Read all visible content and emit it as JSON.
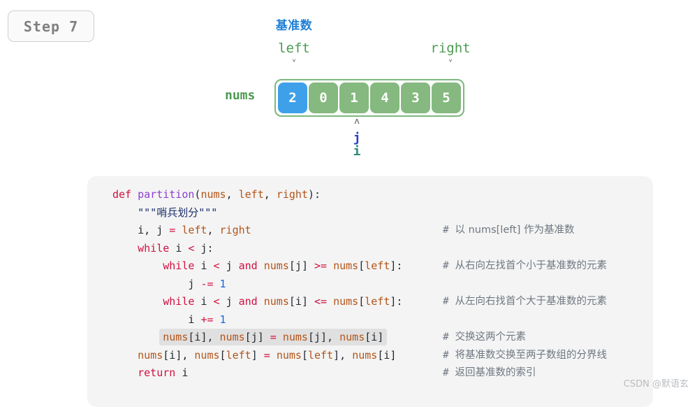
{
  "step_badge": {
    "label": "Step 7"
  },
  "diagram": {
    "pivot_title": "基准数",
    "left_label": "left",
    "right_label": "right",
    "nums_label": "nums",
    "caret_down": "ᵛ",
    "caret_up": "ᴧ",
    "pointer_j": "j",
    "pointer_i": "i",
    "colors": {
      "pivot_title": "#1d7fd6",
      "pointer_label": "#4c9a52",
      "cell_green": "#85b97f",
      "cell_blue": "#3fa0ea",
      "array_border": "#7cb87e",
      "j": "#2a40c8",
      "i": "#2d8a78"
    },
    "array": {
      "values": [
        "2",
        "0",
        "1",
        "4",
        "3",
        "5"
      ],
      "highlight_index": 0,
      "left_index": 0,
      "right_index": 5,
      "i_index": 2,
      "j_index": 2
    }
  },
  "code": {
    "language": "python",
    "highlight_line": 8,
    "lines": [
      {
        "n": 0,
        "indent": 0,
        "tokens": [
          {
            "t": "def",
            "c": "k"
          },
          {
            "t": " ",
            "c": "pl"
          },
          {
            "t": "partition",
            "c": "fn"
          },
          {
            "t": "(",
            "c": "pl"
          },
          {
            "t": "nums",
            "c": "id"
          },
          {
            "t": ", ",
            "c": "pl"
          },
          {
            "t": "left",
            "c": "id"
          },
          {
            "t": ", ",
            "c": "pl"
          },
          {
            "t": "right",
            "c": "id"
          },
          {
            "t": "):",
            "c": "pl"
          }
        ],
        "comment": ""
      },
      {
        "n": 1,
        "indent": 1,
        "tokens": [
          {
            "t": "\"\"\"哨兵划分\"\"\"",
            "c": "str"
          }
        ],
        "comment": ""
      },
      {
        "n": 2,
        "indent": 1,
        "tokens": [
          {
            "t": "i",
            "c": "pl"
          },
          {
            "t": ", ",
            "c": "pl"
          },
          {
            "t": "j",
            "c": "pl"
          },
          {
            "t": " ",
            "c": "pl"
          },
          {
            "t": "=",
            "c": "op"
          },
          {
            "t": " ",
            "c": "pl"
          },
          {
            "t": "left",
            "c": "id"
          },
          {
            "t": ", ",
            "c": "pl"
          },
          {
            "t": "right",
            "c": "id"
          }
        ],
        "comment": "# 以 nums[left] 作为基准数"
      },
      {
        "n": 3,
        "indent": 1,
        "tokens": [
          {
            "t": "while",
            "c": "k"
          },
          {
            "t": " ",
            "c": "pl"
          },
          {
            "t": "i",
            "c": "pl"
          },
          {
            "t": " ",
            "c": "pl"
          },
          {
            "t": "<",
            "c": "op"
          },
          {
            "t": " ",
            "c": "pl"
          },
          {
            "t": "j",
            "c": "pl"
          },
          {
            "t": ":",
            "c": "pl"
          }
        ],
        "comment": ""
      },
      {
        "n": 4,
        "indent": 2,
        "tokens": [
          {
            "t": "while",
            "c": "k"
          },
          {
            "t": " ",
            "c": "pl"
          },
          {
            "t": "i",
            "c": "pl"
          },
          {
            "t": " ",
            "c": "pl"
          },
          {
            "t": "<",
            "c": "op"
          },
          {
            "t": " ",
            "c": "pl"
          },
          {
            "t": "j",
            "c": "pl"
          },
          {
            "t": " ",
            "c": "pl"
          },
          {
            "t": "and",
            "c": "k"
          },
          {
            "t": " ",
            "c": "pl"
          },
          {
            "t": "nums",
            "c": "id"
          },
          {
            "t": "[",
            "c": "pl"
          },
          {
            "t": "j",
            "c": "pl"
          },
          {
            "t": "]",
            "c": "pl"
          },
          {
            "t": " ",
            "c": "pl"
          },
          {
            "t": ">=",
            "c": "op"
          },
          {
            "t": " ",
            "c": "pl"
          },
          {
            "t": "nums",
            "c": "id"
          },
          {
            "t": "[",
            "c": "pl"
          },
          {
            "t": "left",
            "c": "id"
          },
          {
            "t": "]:",
            "c": "pl"
          }
        ],
        "comment": "# 从右向左找首个小于基准数的元素"
      },
      {
        "n": 5,
        "indent": 3,
        "tokens": [
          {
            "t": "j",
            "c": "pl"
          },
          {
            "t": " ",
            "c": "pl"
          },
          {
            "t": "-=",
            "c": "op"
          },
          {
            "t": " ",
            "c": "pl"
          },
          {
            "t": "1",
            "c": "num"
          }
        ],
        "comment": ""
      },
      {
        "n": 6,
        "indent": 2,
        "tokens": [
          {
            "t": "while",
            "c": "k"
          },
          {
            "t": " ",
            "c": "pl"
          },
          {
            "t": "i",
            "c": "pl"
          },
          {
            "t": " ",
            "c": "pl"
          },
          {
            "t": "<",
            "c": "op"
          },
          {
            "t": " ",
            "c": "pl"
          },
          {
            "t": "j",
            "c": "pl"
          },
          {
            "t": " ",
            "c": "pl"
          },
          {
            "t": "and",
            "c": "k"
          },
          {
            "t": " ",
            "c": "pl"
          },
          {
            "t": "nums",
            "c": "id"
          },
          {
            "t": "[",
            "c": "pl"
          },
          {
            "t": "i",
            "c": "pl"
          },
          {
            "t": "]",
            "c": "pl"
          },
          {
            "t": " ",
            "c": "pl"
          },
          {
            "t": "<=",
            "c": "op"
          },
          {
            "t": " ",
            "c": "pl"
          },
          {
            "t": "nums",
            "c": "id"
          },
          {
            "t": "[",
            "c": "pl"
          },
          {
            "t": "left",
            "c": "id"
          },
          {
            "t": "]:",
            "c": "pl"
          }
        ],
        "comment": "# 从左向右找首个大于基准数的元素"
      },
      {
        "n": 7,
        "indent": 3,
        "tokens": [
          {
            "t": "i",
            "c": "pl"
          },
          {
            "t": " ",
            "c": "pl"
          },
          {
            "t": "+=",
            "c": "op"
          },
          {
            "t": " ",
            "c": "pl"
          },
          {
            "t": "1",
            "c": "num"
          }
        ],
        "comment": ""
      },
      {
        "n": 8,
        "indent": 2,
        "highlight": true,
        "tokens": [
          {
            "t": "nums",
            "c": "id"
          },
          {
            "t": "[",
            "c": "pl"
          },
          {
            "t": "i",
            "c": "pl"
          },
          {
            "t": "], ",
            "c": "pl"
          },
          {
            "t": "nums",
            "c": "id"
          },
          {
            "t": "[",
            "c": "pl"
          },
          {
            "t": "j",
            "c": "pl"
          },
          {
            "t": "] ",
            "c": "pl"
          },
          {
            "t": "=",
            "c": "op"
          },
          {
            "t": " ",
            "c": "pl"
          },
          {
            "t": "nums",
            "c": "id"
          },
          {
            "t": "[",
            "c": "pl"
          },
          {
            "t": "j",
            "c": "pl"
          },
          {
            "t": "], ",
            "c": "pl"
          },
          {
            "t": "nums",
            "c": "id"
          },
          {
            "t": "[",
            "c": "pl"
          },
          {
            "t": "i",
            "c": "pl"
          },
          {
            "t": "]",
            "c": "pl"
          }
        ],
        "comment": "# 交换这两个元素"
      },
      {
        "n": 9,
        "indent": 1,
        "tokens": [
          {
            "t": "nums",
            "c": "id"
          },
          {
            "t": "[",
            "c": "pl"
          },
          {
            "t": "i",
            "c": "pl"
          },
          {
            "t": "], ",
            "c": "pl"
          },
          {
            "t": "nums",
            "c": "id"
          },
          {
            "t": "[",
            "c": "pl"
          },
          {
            "t": "left",
            "c": "id"
          },
          {
            "t": "] ",
            "c": "pl"
          },
          {
            "t": "=",
            "c": "op"
          },
          {
            "t": " ",
            "c": "pl"
          },
          {
            "t": "nums",
            "c": "id"
          },
          {
            "t": "[",
            "c": "pl"
          },
          {
            "t": "left",
            "c": "id"
          },
          {
            "t": "], ",
            "c": "pl"
          },
          {
            "t": "nums",
            "c": "id"
          },
          {
            "t": "[",
            "c": "pl"
          },
          {
            "t": "i",
            "c": "pl"
          },
          {
            "t": "]",
            "c": "pl"
          }
        ],
        "comment": "# 将基准数交换至两子数组的分界线"
      },
      {
        "n": 10,
        "indent": 1,
        "tokens": [
          {
            "t": "return",
            "c": "k"
          },
          {
            "t": " ",
            "c": "pl"
          },
          {
            "t": "i",
            "c": "pl"
          }
        ],
        "comment": "# 返回基准数的索引"
      }
    ]
  },
  "watermark": {
    "text": "CSDN @默语玄"
  }
}
